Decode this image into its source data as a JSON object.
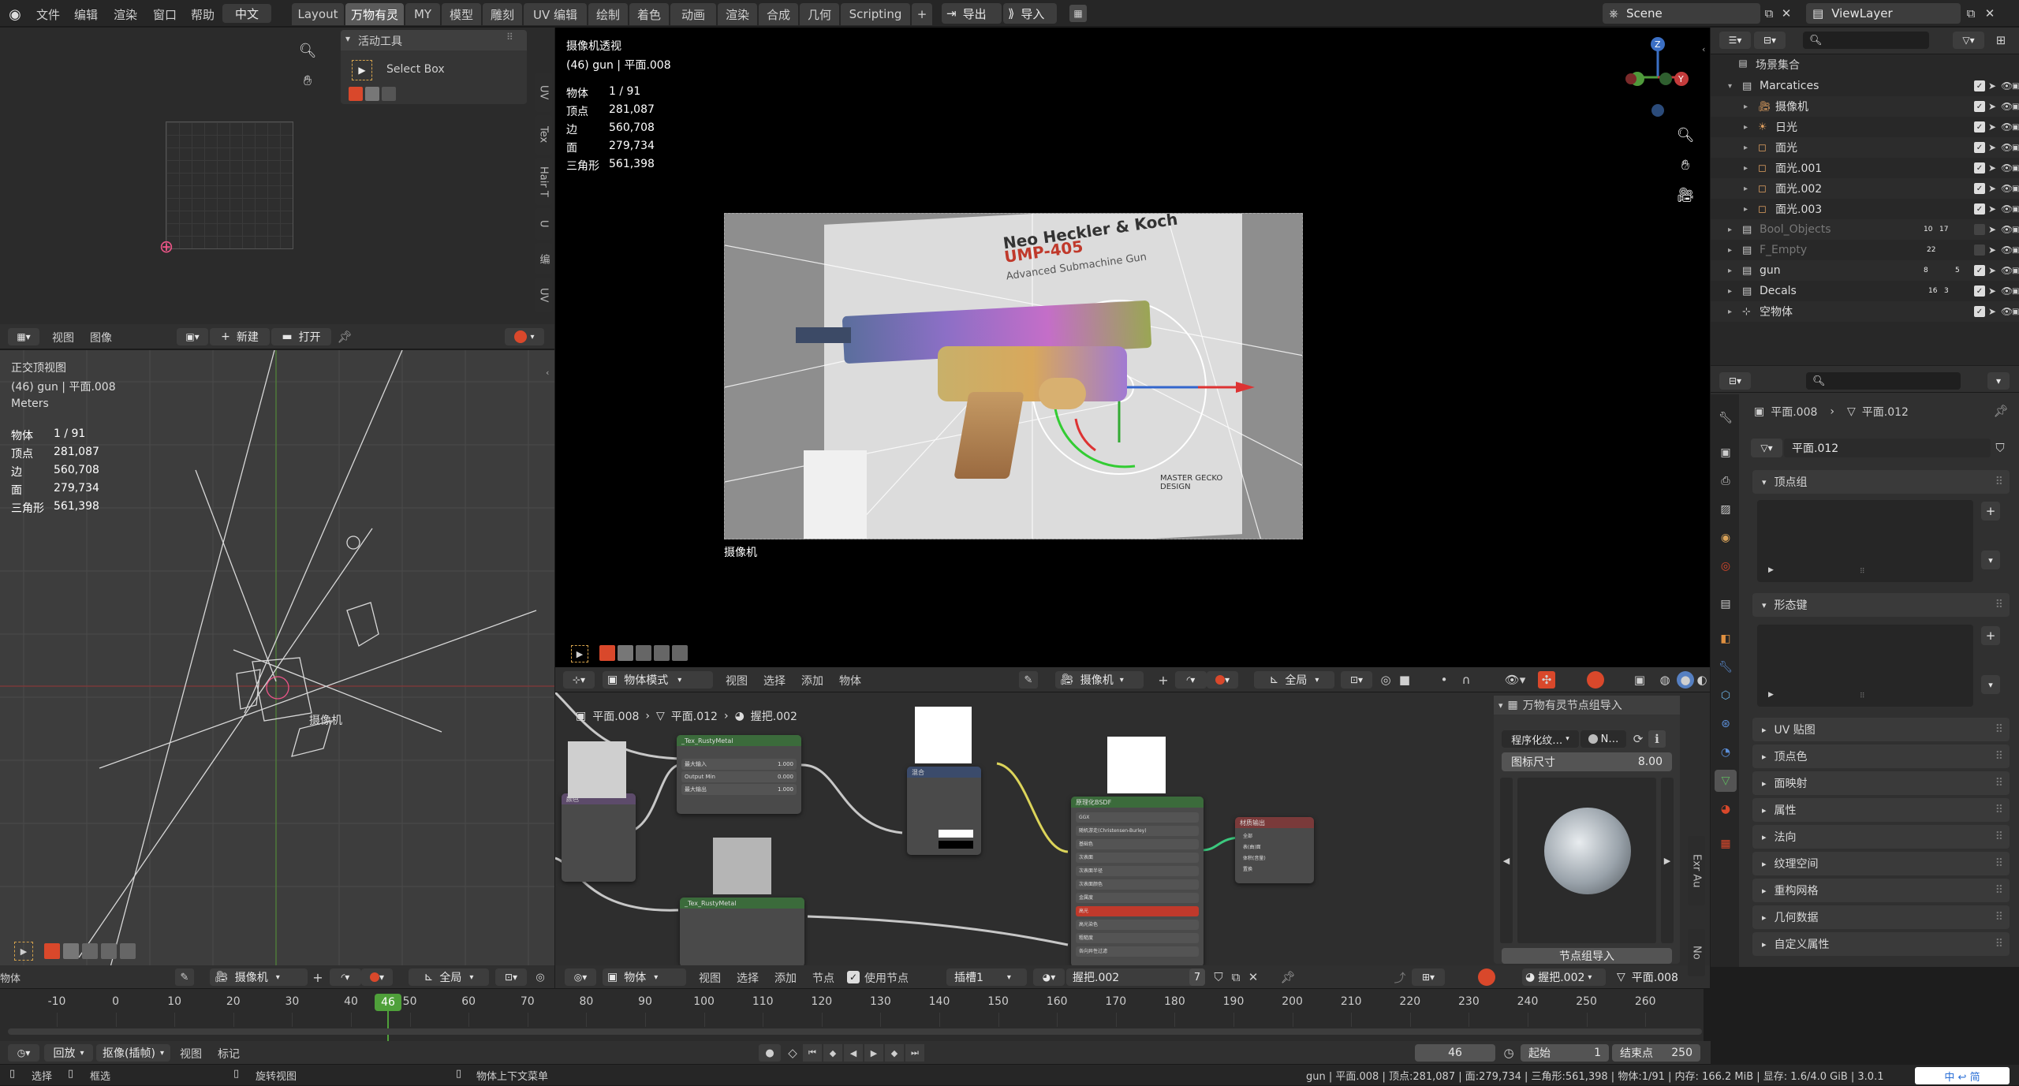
{
  "menu": {
    "file": "文件",
    "edit": "编辑",
    "render": "渲染",
    "window": "窗口",
    "help": "帮助",
    "lang": "中文"
  },
  "workspaces": [
    "Layout",
    "万物有灵",
    "MY",
    "模型",
    "雕刻",
    "UV 编辑",
    "绘制",
    "着色",
    "动画",
    "渲染",
    "合成",
    "几何",
    "Scripting"
  ],
  "export_label": "导出",
  "import_label": "导入",
  "scene": "Scene",
  "viewlayer": "ViewLayer",
  "tool_panel": {
    "header": "活动工具",
    "tool": "Select Box"
  },
  "uv_sidetabs": [
    "UV",
    "Tex",
    "Hair T",
    "U",
    "编",
    "UV"
  ],
  "image_editor_header": {
    "view": "视图",
    "image": "图像",
    "new": "新建",
    "open": "打开"
  },
  "ortho_view": {
    "title": "正交顶视图",
    "object": "(46) gun | 平面.008",
    "units": "Meters",
    "camera_label": "摄像机"
  },
  "stats_labels": [
    "物体",
    "顶点",
    "边",
    "面",
    "三角形"
  ],
  "stats_values": [
    "1 / 91",
    "281,087",
    "560,708",
    "279,734",
    "561,398"
  ],
  "camera_view": {
    "title": "摄像机透视",
    "object": "(46) gun | 平面.008",
    "camera_label": "摄像机"
  },
  "render_text": {
    "brand": "Neo Heckler & Koch",
    "model": "UMP-405",
    "sub": "Advanced Submachine Gun",
    "design": "MASTER GECKO DESIGN"
  },
  "viewport_header": {
    "mode": "物体模式",
    "view": "视图",
    "select": "选择",
    "add": "添加",
    "object": "物体",
    "camera": "摄像机",
    "global": "全局"
  },
  "node_breadcrumb": [
    "平面.008",
    "平面.012",
    "握把.002"
  ],
  "node_panel": {
    "header": "万物有灵节点组导入",
    "program": "程序化纹…",
    "n": "N…",
    "icon_size_label": "图标尺寸",
    "icon_size_value": "8.00",
    "import_btn": "节点组导入"
  },
  "node_editor_header": {
    "object": "物体",
    "view": "视图",
    "select": "选择",
    "add": "添加",
    "node": "节点",
    "use_nodes": "使用节点",
    "slot": "插槽1",
    "material": "握把.002",
    "users": "7",
    "mesh_name": "握把.002",
    "mesh2": "平面.008"
  },
  "node_sidetabs": [
    "Exr Au",
    "No"
  ],
  "nodes": {
    "n1": "_Tex_RustyMetal",
    "n1_rows": [
      "最大输入",
      "Output Min",
      "最大输出"
    ],
    "n1_vals": [
      "1.000",
      "0.000",
      "1.000"
    ],
    "n2": "颜色",
    "n3": "_Tex_RustyMetal",
    "n4": "原理化BSDF",
    "n4_rows": [
      "GGX",
      "随机游走(Christensen-Burley)",
      "基础色",
      "次表面",
      "次表面半径",
      "次表面颜色",
      "金属度",
      "高光",
      "高光染色",
      "粗糙度",
      "各向异性过滤"
    ],
    "n5": "材质输出",
    "n5_rows": [
      "全部",
      "表(曲)面",
      "体积(音量)",
      "置换"
    ],
    "mix": "混合"
  },
  "outliner": {
    "collection": "场景集合",
    "rows": [
      {
        "name": "Marcatices",
        "indent": 1
      },
      {
        "name": "摄像机",
        "indent": 2
      },
      {
        "name": "日光",
        "indent": 2
      },
      {
        "name": "面光",
        "indent": 2
      },
      {
        "name": "面光.001",
        "indent": 2
      },
      {
        "name": "面光.002",
        "indent": 2
      },
      {
        "name": "面光.003",
        "indent": 2
      },
      {
        "name": "Bool_Objects",
        "indent": 1,
        "dim": true
      },
      {
        "name": "F_Empty",
        "indent": 1,
        "dim": true
      },
      {
        "name": "gun",
        "indent": 1
      },
      {
        "name": "Decals",
        "indent": 1
      },
      {
        "name": "空物体",
        "indent": 1
      }
    ],
    "badges": {
      "bool": "10",
      "bool2": "17",
      "empty": "22",
      "gun1": "8",
      "gun2": "5",
      "decals1": "16",
      "decals2": "3"
    }
  },
  "properties": {
    "path1": "平面.008",
    "path2": "平面.012",
    "mesh": "平面.012",
    "sections": [
      "顶点组",
      "形态键",
      "UV 贴图",
      "顶点色",
      "面映射",
      "属性",
      "法向",
      "纹理空间",
      "重构网格",
      "几何数据",
      "自定义属性"
    ]
  },
  "view3d_header": {
    "camera": "摄像机",
    "global": "全局"
  },
  "timeline": {
    "ticks": [
      "-10",
      "0",
      "10",
      "20",
      "30",
      "40",
      "50",
      "60",
      "70",
      "80",
      "90",
      "100",
      "110",
      "120",
      "130",
      "140",
      "150",
      "160",
      "170",
      "180",
      "190",
      "200",
      "210",
      "220",
      "230",
      "240",
      "250",
      "260"
    ],
    "current": "46",
    "playback": "回放",
    "keying": "抠像(插帧)",
    "view": "视图",
    "marker": "标记",
    "frame": "46",
    "start_label": "起始",
    "start": "1",
    "end_label": "结束点",
    "end": "250"
  },
  "statusbar": {
    "select": "选择",
    "box": "框选",
    "rotate": "旋转视图",
    "menu": "物体上下文菜单",
    "info": "gun | 平面.008 | 顶点:281,087 | 面:279,734 | 三角形:561,398 | 物体:1/91 | 内存: 166.2 MiB | 显存: 1.6/4.0 GiB | 3.0.1",
    "ime": "中 ↩ 简"
  },
  "left_edge_label": "物体",
  "colors": {
    "accent": "#4772b3",
    "header": "#303030",
    "panel": "#2b2b2b",
    "active": "#5680c2",
    "frame": "#4fa03a",
    "red": "#d9482b"
  }
}
